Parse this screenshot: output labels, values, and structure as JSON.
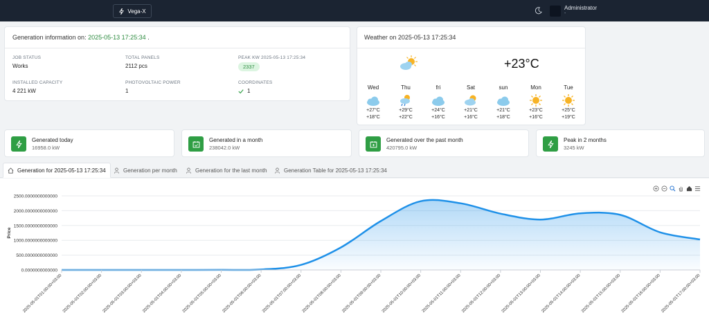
{
  "header": {
    "brand": "Vega-X",
    "user_name": "Administrator",
    "user_sub": "-"
  },
  "generation_info": {
    "title_prefix": "Generation information on:",
    "datetime": "2025-05-13 17:25:34",
    "title_suffix": ".",
    "job_status_label": "JOB STATUS",
    "job_status": "Works",
    "total_panels_label": "TOTAL PANELS",
    "total_panels": "2112 pcs",
    "peak_kw_label": "PEAK KW 2025-05-13 17:25:34",
    "peak_kw": "2337",
    "installed_capacity_label": "INSTALLED CAPACITY",
    "installed_capacity": "4 221 kW",
    "pv_power_label": "PHOTOVOLTAIC POWER",
    "pv_power": "1",
    "coordinates_label": "COORDINATES",
    "coordinates": "1"
  },
  "weather": {
    "title": "Weather on 2025-05-13 17:25:34",
    "current_temp": "+23°C",
    "current_icon": "sun-cloud-icon",
    "days": [
      {
        "name": "Wed",
        "icon": "cloud-icon",
        "hi": "+27°C",
        "lo": "+18°C"
      },
      {
        "name": "Thu",
        "icon": "sun-rain-icon",
        "hi": "+29°C",
        "lo": "+22°C"
      },
      {
        "name": "fri",
        "icon": "cloud-icon",
        "hi": "+24°C",
        "lo": "+16°C"
      },
      {
        "name": "Sat",
        "icon": "sun-cloud-icon",
        "hi": "+21°C",
        "lo": "+16°C"
      },
      {
        "name": "sun",
        "icon": "cloud-icon",
        "hi": "+21°C",
        "lo": "+18°C"
      },
      {
        "name": "Mon",
        "icon": "sun-icon",
        "hi": "+23°C",
        "lo": "+16°C"
      },
      {
        "name": "Tue",
        "icon": "sun-icon",
        "hi": "+25°C",
        "lo": "+19°C"
      }
    ]
  },
  "stats": [
    {
      "title": "Generated today",
      "value": "16958.0 kW",
      "icon": "bolt-icon"
    },
    {
      "title": "Generated in a month",
      "value": "238042.0 kW",
      "icon": "calendar-check-icon"
    },
    {
      "title": "Generated over the past month",
      "value": "420795.0 kW",
      "icon": "calendar-plus-icon"
    },
    {
      "title": "Peak in 2 months",
      "value": "3245 kW",
      "icon": "bolt-icon"
    }
  ],
  "tabs": [
    {
      "label": "Generation for 2025-05-13 17:25:34",
      "icon": "home-icon"
    },
    {
      "label": "Generation per month",
      "icon": "user-icon"
    },
    {
      "label": "Generation for the last month",
      "icon": "user-icon"
    },
    {
      "label": "Generation Table for 2025-05-13 17:25:34",
      "icon": "user-icon"
    }
  ],
  "colors": {
    "accent_green": "#2f9e44",
    "line_blue": "#1e90e8",
    "topbar": "#1b2432"
  },
  "chart_data": {
    "type": "area",
    "title": "",
    "xlabel": "",
    "ylabel": "Price",
    "ylim": [
      0,
      2500
    ],
    "yticks": [
      "0.0000000000000",
      "500.0000000000000",
      "1000.0000000000000",
      "1500.0000000000000",
      "2000.0000000000000",
      "2500.0000000000000"
    ],
    "x": [
      "2025-05-01T01:00:00+03:00",
      "2025-05-01T02:00:00+03:00",
      "2025-05-01T03:00:00+03:00",
      "2025-05-01T04:00:00+03:00",
      "2025-05-01T05:00:00+03:00",
      "2025-05-01T06:00:00+03:00",
      "2025-05-01T07:00:00+03:00",
      "2025-05-01T08:00:00+03:00",
      "2025-05-01T09:00:00+03:00",
      "2025-05-01T10:00:00+03:00",
      "2025-05-01T11:00:00+03:00",
      "2025-05-01T12:00:00+03:00",
      "2025-05-01T13:00:00+03:00",
      "2025-05-01T14:00:00+03:00",
      "2025-05-01T15:00:00+03:00",
      "2025-05-01T16:00:00+03:00",
      "2025-05-01T17:00:00+03:00"
    ],
    "series": [
      {
        "values": [
          0,
          0,
          0,
          0,
          2,
          15,
          170,
          760,
          1650,
          2320,
          2250,
          1900,
          1700,
          1910,
          1860,
          1270,
          1030
        ]
      }
    ],
    "grid": true
  }
}
